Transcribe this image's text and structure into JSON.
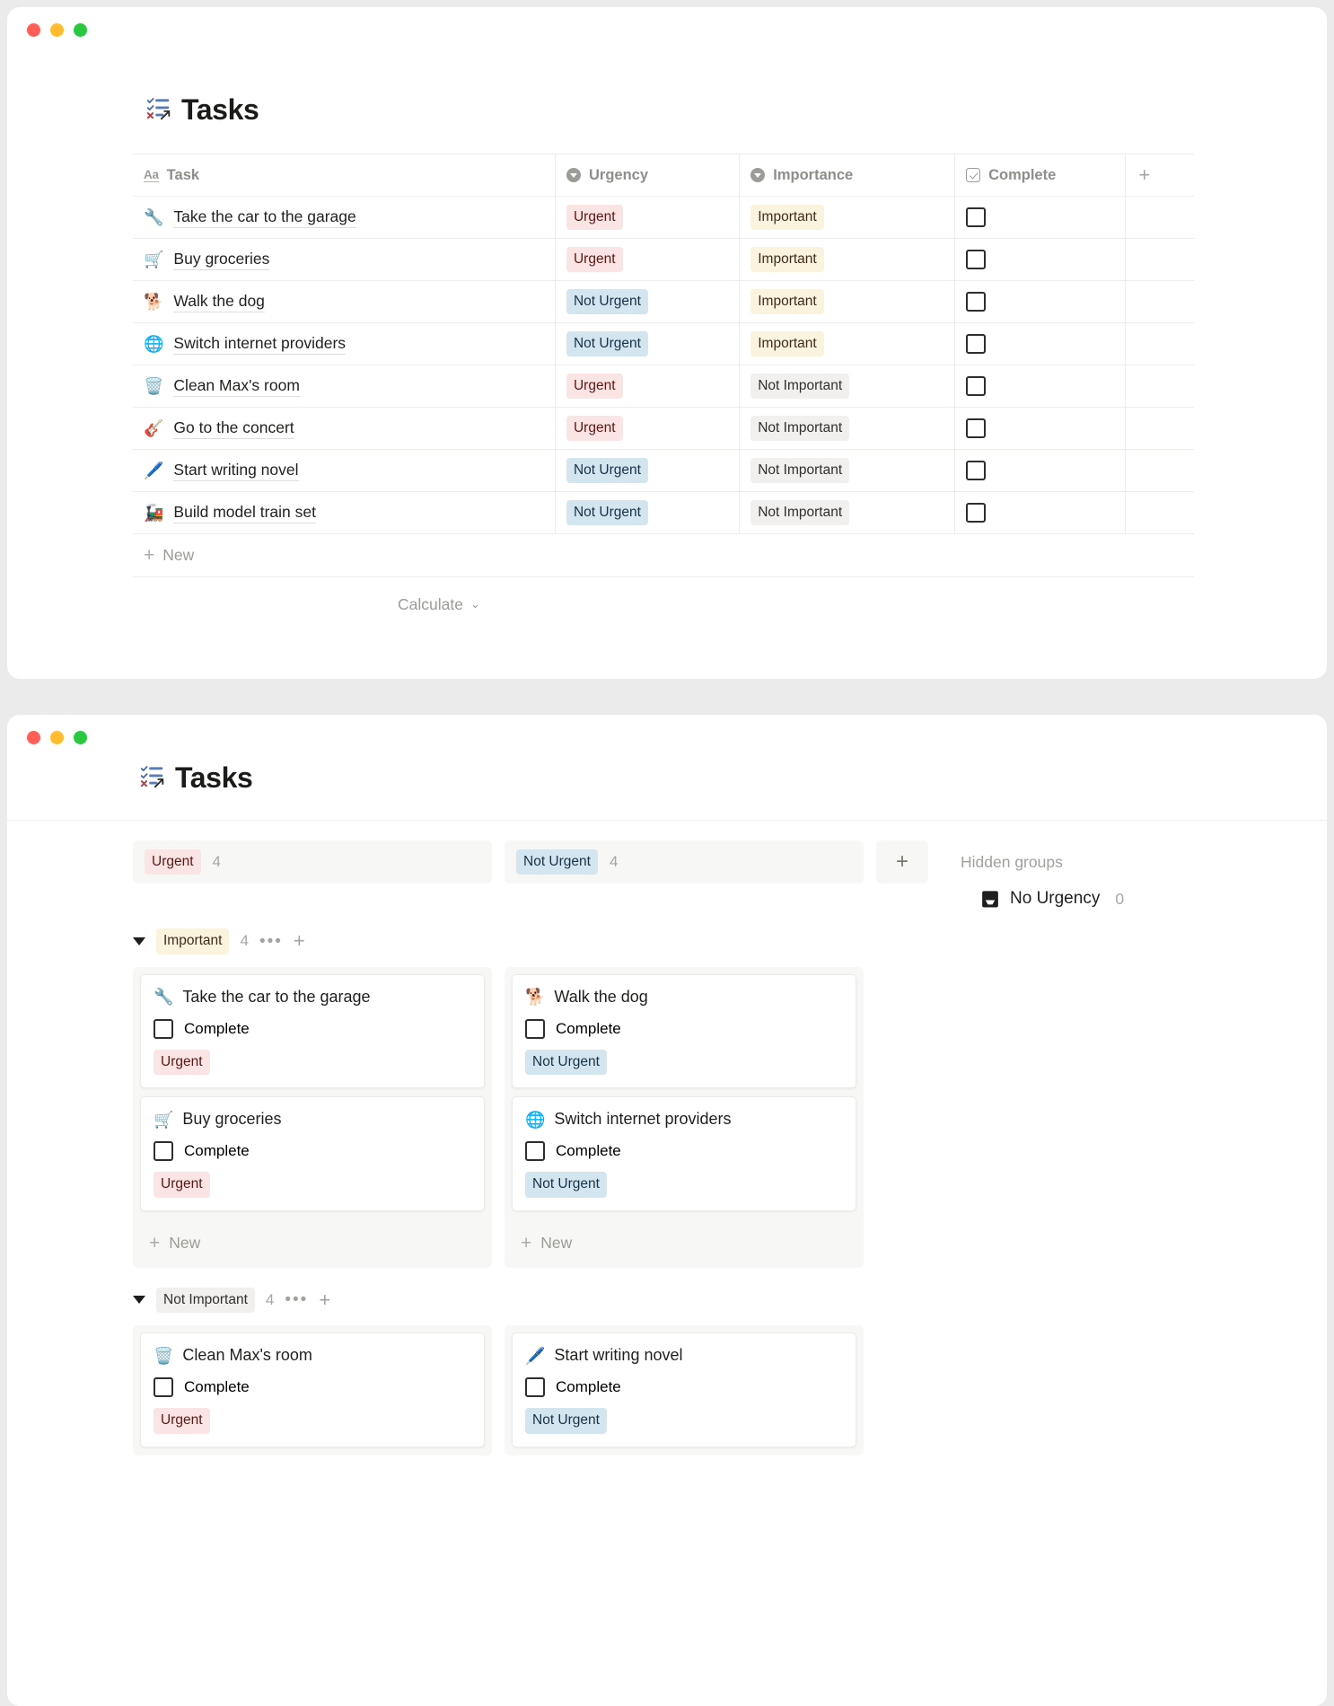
{
  "window1": {
    "traffic_lights": [
      "close",
      "minimize",
      "maximize"
    ],
    "page_emoji": "🗒️",
    "page_title": "Tasks",
    "table": {
      "columns": [
        {
          "label": "Task",
          "icon": "text-property-icon"
        },
        {
          "label": "Urgency",
          "icon": "select-property-icon"
        },
        {
          "label": "Importance",
          "icon": "select-property-icon"
        },
        {
          "label": "Complete",
          "icon": "checkbox-property-icon"
        },
        {
          "label": "+",
          "icon": "add-column-icon"
        }
      ],
      "rows": [
        {
          "emoji": "🔧",
          "task": "Take the car to the garage",
          "urgency": "Urgent",
          "importance": "Important",
          "complete": false
        },
        {
          "emoji": "🛒",
          "task": "Buy groceries",
          "urgency": "Urgent",
          "importance": "Important",
          "complete": false
        },
        {
          "emoji": "🐕",
          "task": "Walk the dog",
          "urgency": "Not Urgent",
          "importance": "Important",
          "complete": false
        },
        {
          "emoji": "🌐",
          "task": "Switch internet providers",
          "urgency": "Not Urgent",
          "importance": "Important",
          "complete": false
        },
        {
          "emoji": "🗑️",
          "task": "Clean Max's room",
          "urgency": "Urgent",
          "importance": "Not Important",
          "complete": false
        },
        {
          "emoji": "🎸",
          "task": "Go to the concert",
          "urgency": "Urgent",
          "importance": "Not Important",
          "complete": false
        },
        {
          "emoji": "🖊️",
          "task": "Start writing novel",
          "urgency": "Not Urgent",
          "importance": "Not Important",
          "complete": false
        },
        {
          "emoji": "🚂",
          "task": "Build model train set",
          "urgency": "Not Urgent",
          "importance": "Not Important",
          "complete": false
        }
      ],
      "new_row_label": "New",
      "calculate_label": "Calculate"
    }
  },
  "window2": {
    "page_emoji": "🗒️",
    "page_title": "Tasks",
    "board": {
      "columns": [
        {
          "label": "Urgent",
          "count": "4",
          "style": "urgent"
        },
        {
          "label": "Not Urgent",
          "count": "4",
          "style": "not-urgent"
        }
      ],
      "add_column_label": "+",
      "hidden_groups_label": "Hidden groups",
      "hidden_groups": [
        {
          "icon": "tray-icon",
          "label": "No Urgency",
          "count": "0"
        }
      ],
      "groups": [
        {
          "label": "Important",
          "style": "important",
          "count": "4",
          "menu_label": "•••",
          "add_label": "+",
          "lanes": [
            {
              "new_label": "New",
              "cards": [
                {
                  "emoji": "🔧",
                  "title": "Take the car to the garage",
                  "check_label": "Complete",
                  "complete": false,
                  "tag": "Urgent",
                  "tag_style": "urgent"
                },
                {
                  "emoji": "🛒",
                  "title": "Buy groceries",
                  "check_label": "Complete",
                  "complete": false,
                  "tag": "Urgent",
                  "tag_style": "urgent"
                }
              ]
            },
            {
              "new_label": "New",
              "cards": [
                {
                  "emoji": "🐕",
                  "title": "Walk the dog",
                  "check_label": "Complete",
                  "complete": false,
                  "tag": "Not Urgent",
                  "tag_style": "not-urgent"
                },
                {
                  "emoji": "🌐",
                  "title": "Switch internet providers",
                  "check_label": "Complete",
                  "complete": false,
                  "tag": "Not Urgent",
                  "tag_style": "not-urgent"
                }
              ]
            }
          ]
        },
        {
          "label": "Not Important",
          "style": "not-important",
          "count": "4",
          "menu_label": "•••",
          "add_label": "+",
          "lanes": [
            {
              "new_label": "New",
              "cards": [
                {
                  "emoji": "🗑️",
                  "title": "Clean Max's room",
                  "check_label": "Complete",
                  "complete": false,
                  "tag": "Urgent",
                  "tag_style": "urgent"
                }
              ]
            },
            {
              "new_label": "New",
              "cards": [
                {
                  "emoji": "🖊️",
                  "title": "Start writing novel",
                  "check_label": "Complete",
                  "complete": false,
                  "tag": "Not Urgent",
                  "tag_style": "not-urgent"
                }
              ]
            }
          ]
        }
      ]
    }
  },
  "colors": {
    "urgent_bg": "#fbe4e4",
    "urgent_fg": "#5d1715",
    "not_urgent_bg": "#d3e5ef",
    "not_urgent_fg": "#183347",
    "important_bg": "#faf3dd",
    "important_fg": "#402c1b",
    "not_important_bg": "#f1f0ef",
    "not_important_fg": "#32302c",
    "window_bg": "#ffffff",
    "desktop_bg": "#ebebeb"
  }
}
